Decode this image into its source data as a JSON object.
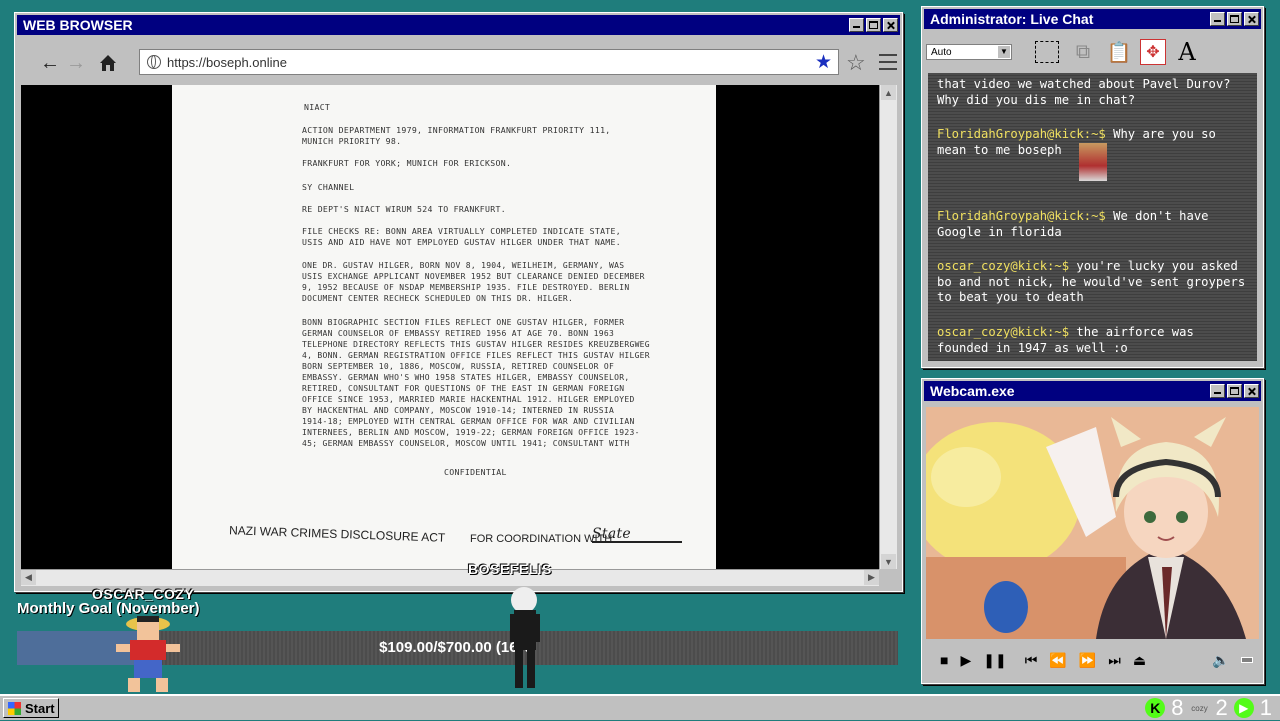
{
  "browser": {
    "title": "WEB BROWSER",
    "url": "https://boseph.online",
    "document": {
      "header": "NIACT",
      "lines": [
        "ACTION DEPARTMENT 1979, INFORMATION FRANKFURT PRIORITY 111,",
        "MUNICH PRIORITY 98.",
        "FRANKFURT FOR YORK; MUNICH FOR ERICKSON.",
        "SY CHANNEL",
        "RE DEPT'S NIACT WIRUM 524 TO FRANKFURT.",
        "FILE CHECKS RE: BONN AREA VIRTUALLY COMPLETED INDICATE STATE,",
        "USIS AND AID HAVE NOT EMPLOYED GUSTAV HILGER UNDER THAT NAME.",
        "ONE DR. GUSTAV HILGER, BORN NOV 8, 1904, WEILHEIM, GERMANY, WAS",
        "USIS EXCHANGE APPLICANT NOVEMBER 1952 BUT CLEARANCE DENIED DECEMBER",
        "9, 1952 BECAUSE OF NSDAP MEMBERSHIP 1935. FILE DESTROYED. BERLIN",
        "DOCUMENT CENTER RECHECK SCHEDULED ON THIS DR. HILGER.",
        "BONN BIOGRAPHIC SECTION FILES REFLECT ONE GUSTAV HILGER, FORMER",
        "GERMAN COUNSELOR OF EMBASSY RETIRED 1956 AT AGE 70. BONN 1963",
        "TELEPHONE DIRECTORY REFLECTS THIS GUSTAV HILGER RESIDES KREUZBERGWEG",
        "4, BONN. GERMAN REGISTRATION OFFICE FILES REFLECT THIS GUSTAV HILGER",
        "BORN SEPTEMBER 10, 1886, MOSCOW, RUSSIA, RETIRED COUNSELOR OF",
        "EMBASSY. GERMAN WHO'S WHO 1958 STATES HILGER, EMBASSY COUNSELOR,",
        "RETIRED, CONSULTANT FOR QUESTIONS OF THE EAST IN GERMAN FOREIGN",
        "OFFICE SINCE 1953, MARRIED MARIE HACKENTHAL 1912. HILGER EMPLOYED",
        "BY HACKENTHAL AND COMPANY, MOSCOW 1910-14; INTERNED IN RUSSIA",
        "1914-18; EMPLOYED WITH CENTRAL GERMAN OFFICE FOR WAR AND CIVILIAN",
        "INTERNEES, BERLIN AND MOSCOW, 1919-22; GERMAN FOREIGN OFFICE 1923-",
        "45; GERMAN EMBASSY COUNSELOR, MOSCOW UNTIL 1941; CONSULTANT WITH"
      ],
      "confidential": "CONFIDENTIAL",
      "footer_left": "NAZI WAR CRIMES DISCLOSURE ACT",
      "footer_right": "FOR COORDINATION WITH",
      "signature": "State"
    }
  },
  "chat": {
    "title": "Administrator: Live Chat",
    "font_select": "Auto",
    "messages": [
      {
        "user": "",
        "text": "that video we watched about Pavel Durov? Why did you dis me in chat?"
      },
      {
        "user": "FloridahGroypah@kick:~$",
        "text": "Why are you so mean to me boseph"
      },
      {
        "user": "FloridahGroypah@kick:~$",
        "text": "We don't have Google in florida"
      },
      {
        "user": "oscar_cozy@kick:~$",
        "text": "you're lucky you asked bo and not nick, he would've sent groypers to beat you to death"
      },
      {
        "user": "oscar_cozy@kick:~$",
        "text": "the airforce was founded in 1947 as well :o"
      }
    ]
  },
  "webcam": {
    "title": "Webcam.exe"
  },
  "goal": {
    "title": "Monthly Goal (November)",
    "text": "$109.00/$700.00 (16%)",
    "progress": 0.16,
    "tag_left": "OSCAR_COZY",
    "tag_right": "BOSEFELIS"
  },
  "taskbar": {
    "start_label": "Start",
    "kick_count": "8",
    "cozy_label": "cozy",
    "cozy_count": "2",
    "other_count": "1"
  },
  "colors": {
    "desktop": "#1f7d7c",
    "titlebar": "#000080",
    "goal_fill": "#4e6e9a",
    "kick_green": "#53fc18"
  }
}
